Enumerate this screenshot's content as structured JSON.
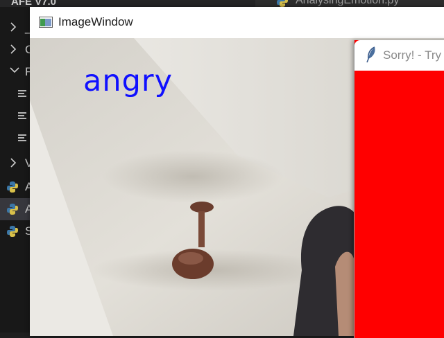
{
  "vscode": {
    "explorer_title": "AFE V7.0",
    "editor_tab_label": "AnalysingEmotion.py",
    "tree": [
      {
        "kind": "folder-collapsed",
        "label": "_"
      },
      {
        "kind": "folder-collapsed",
        "label": "C"
      },
      {
        "kind": "folder-expanded",
        "label": "F"
      },
      {
        "kind": "file",
        "label": ""
      },
      {
        "kind": "file",
        "label": ""
      },
      {
        "kind": "file",
        "label": ""
      },
      {
        "kind": "folder-collapsed",
        "label": "V"
      },
      {
        "kind": "python",
        "label": "A"
      },
      {
        "kind": "python",
        "label": "A",
        "selected": true
      },
      {
        "kind": "python",
        "label": "S"
      }
    ]
  },
  "image_window": {
    "title": "ImageWindow",
    "emotion_label": "angry",
    "emotion_color": "#1010ff"
  },
  "sorry_window": {
    "title": "Sorry! - Try",
    "background_color": "#ff0000"
  }
}
